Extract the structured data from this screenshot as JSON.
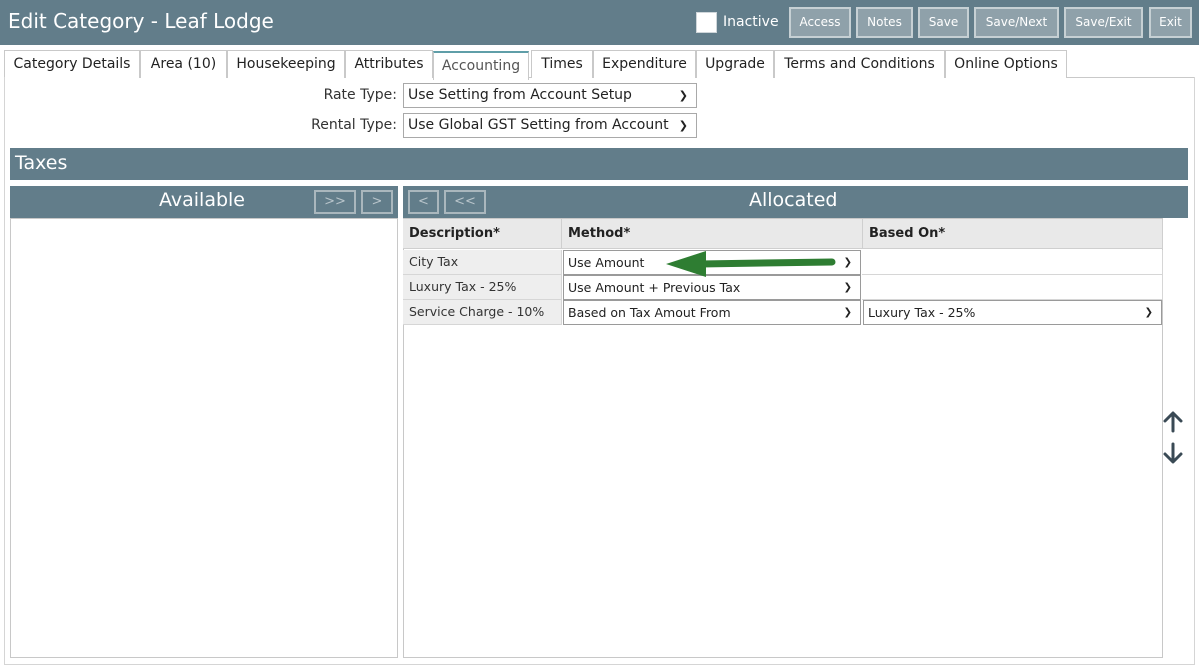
{
  "header": {
    "title": "Edit Category - Leaf Lodge",
    "inactive_label": "Inactive",
    "buttons": [
      "Access",
      "Notes",
      "Save",
      "Save/Next",
      "Save/Exit",
      "Exit"
    ]
  },
  "tabs": [
    {
      "label": "Category Details"
    },
    {
      "label": "Area (10)"
    },
    {
      "label": "Housekeeping"
    },
    {
      "label": "Attributes"
    },
    {
      "label": "Accounting",
      "active": true
    },
    {
      "label": "Times"
    },
    {
      "label": "Expenditure"
    },
    {
      "label": "Upgrade"
    },
    {
      "label": "Terms and Conditions"
    },
    {
      "label": "Online Options"
    }
  ],
  "form": {
    "rate_type_label": "Rate Type:",
    "rate_type_value": "Use Setting from Account Setup",
    "rental_type_label": "Rental Type:",
    "rental_type_value": "Use Global GST Setting from Account"
  },
  "taxes": {
    "title": "Taxes",
    "available_title": "Available",
    "allocated_title": "Allocated",
    "btn_add_all": ">>",
    "btn_add": ">",
    "btn_remove": "<",
    "btn_remove_all": "<<",
    "columns": [
      "Description*",
      "Method*",
      "Based On*"
    ],
    "rows": [
      {
        "description": "City Tax",
        "method": "Use Amount",
        "based_on": ""
      },
      {
        "description": "Luxury Tax - 25%",
        "method": "Use Amount + Previous Tax",
        "based_on": ""
      },
      {
        "description": "Service Charge - 10%",
        "method": "Based on Tax Amout From",
        "based_on": "Luxury Tax - 25%"
      }
    ]
  },
  "colors": {
    "header": "#627d8a",
    "arrow": "#2e7d32",
    "active_tab_accent": "#5f9ea8"
  },
  "icons": {
    "move_up": "arrow-up-icon",
    "move_down": "arrow-down-icon",
    "annotation": "green-arrow-icon"
  }
}
